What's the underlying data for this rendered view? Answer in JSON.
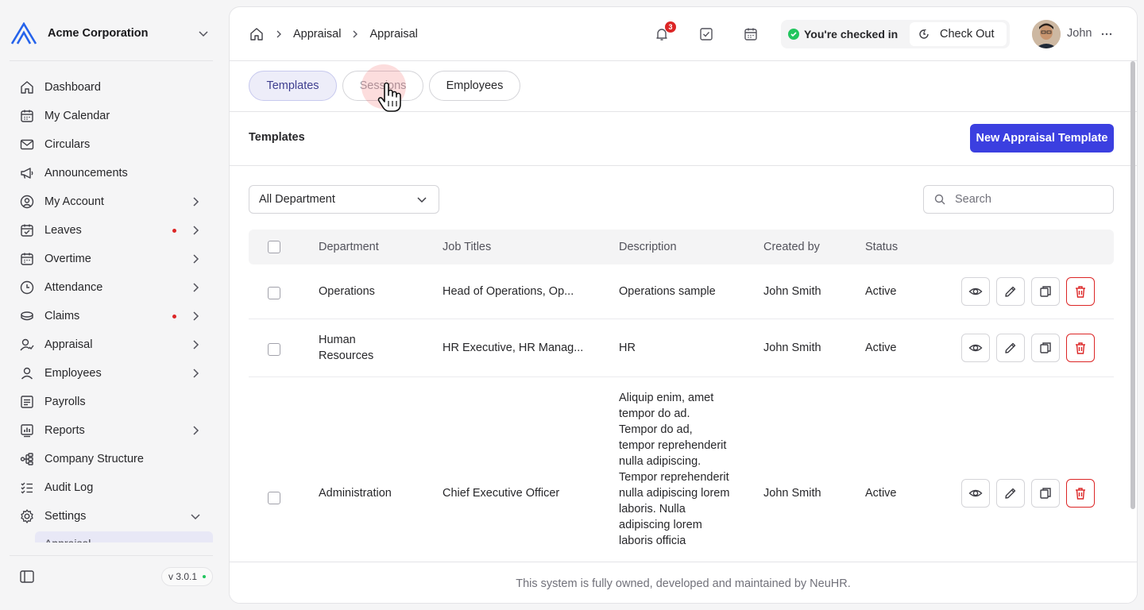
{
  "org": {
    "name": "Acme Corporation",
    "logo": "acme-logo"
  },
  "sidebar": {
    "items": [
      {
        "label": "Dashboard",
        "icon": "home-icon",
        "chevron": false,
        "dot": false
      },
      {
        "label": "My Calendar",
        "icon": "calendar-icon",
        "chevron": false,
        "dot": false
      },
      {
        "label": "Circulars",
        "icon": "mail-icon",
        "chevron": false,
        "dot": false
      },
      {
        "label": "Announcements",
        "icon": "megaphone-icon",
        "chevron": false,
        "dot": false
      },
      {
        "label": "My Account",
        "icon": "user-circle-icon",
        "chevron": true,
        "dot": false
      },
      {
        "label": "Leaves",
        "icon": "calendar-check-icon",
        "chevron": true,
        "dot": true
      },
      {
        "label": "Overtime",
        "icon": "calendar-clock-icon",
        "chevron": true,
        "dot": false
      },
      {
        "label": "Attendance",
        "icon": "clock-icon",
        "chevron": true,
        "dot": false
      },
      {
        "label": "Claims",
        "icon": "coins-icon",
        "chevron": true,
        "dot": true
      },
      {
        "label": "Appraisal",
        "icon": "user-check-icon",
        "chevron": true,
        "dot": false
      },
      {
        "label": "Employees",
        "icon": "user-icon",
        "chevron": true,
        "dot": false
      },
      {
        "label": "Payrolls",
        "icon": "receipt-icon",
        "chevron": false,
        "dot": false
      },
      {
        "label": "Reports",
        "icon": "chart-icon",
        "chevron": true,
        "dot": false
      },
      {
        "label": "Company Structure",
        "icon": "hierarchy-icon",
        "chevron": false,
        "dot": false
      },
      {
        "label": "Audit Log",
        "icon": "list-check-icon",
        "chevron": false,
        "dot": false
      },
      {
        "label": "Settings",
        "icon": "gear-icon",
        "chevron": "down",
        "dot": false
      }
    ],
    "selected_sub": "Appraisal",
    "version": "v 3.0.1"
  },
  "breadcrumb": [
    "Appraisal",
    "Appraisal"
  ],
  "header": {
    "notification_count": "3",
    "checkin_status": "You're checked in",
    "checkout_label": "Check Out",
    "user_name": "John"
  },
  "tabs": [
    {
      "label": "Templates",
      "active": true
    },
    {
      "label": "Sessions",
      "active": false
    },
    {
      "label": "Employees",
      "active": false
    }
  ],
  "section": {
    "title": "Templates",
    "new_button": "New Appraisal Template"
  },
  "filters": {
    "department": "All Department",
    "search_placeholder": "Search"
  },
  "table": {
    "columns": [
      "Department",
      "Job Titles",
      "Description",
      "Created by",
      "Status"
    ],
    "rows": [
      {
        "department": "Operations",
        "job_titles": "Head of Operations, Op...",
        "description": "Operations sample",
        "created_by": "John Smith",
        "status": "Active"
      },
      {
        "department": "Human Resources",
        "job_titles": "HR Executive, HR Manag...",
        "description": "HR",
        "created_by": "John Smith",
        "status": "Active"
      },
      {
        "department": "Administration",
        "job_titles": "Chief Executive Officer",
        "description": "Aliquip enim, amet tempor do ad. Tempor do ad, tempor reprehenderit nulla adipiscing. Tempor reprehenderit nulla adipiscing lorem laboris. Nulla adipiscing lorem laboris officia",
        "created_by": "John Smith",
        "status": "Active"
      }
    ]
  },
  "footer": {
    "text": "This system is fully owned, developed and maintained by NeuHR."
  },
  "colors": {
    "accent": "#3b3fe0",
    "danger": "#dc2626",
    "success": "#22c55e",
    "active_tab_bg": "#ededf9"
  }
}
